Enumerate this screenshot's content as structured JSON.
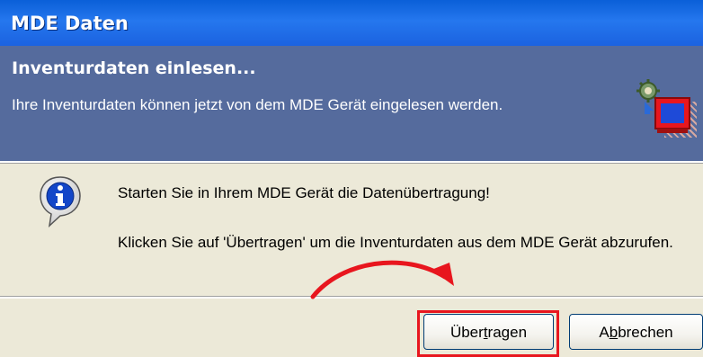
{
  "window": {
    "title": "MDE Daten"
  },
  "header": {
    "title": "Inventurdaten einlesen...",
    "description": "Ihre Inventurdaten können jetzt von dem MDE Gerät eingelesen werden.",
    "icon": "device-transfer-icon"
  },
  "body": {
    "icon": "info-icon",
    "message_line1": "Starten Sie in Ihrem MDE Gerät die Datenübertragung!",
    "message_line2": "Klicken Sie auf 'Übertragen' um die Inventurdaten aus dem MDE Gerät abzurufen."
  },
  "buttons": {
    "transfer": {
      "label_pre": "Über",
      "label_accel": "t",
      "label_post": "ragen",
      "label": "Übertragen"
    },
    "cancel": {
      "label_pre": "A",
      "label_accel": "b",
      "label_post": "brechen",
      "label": "Abbrechen"
    }
  },
  "annotation": {
    "highlight_color": "#e8161e",
    "arrow_color": "#e8161e"
  },
  "colors": {
    "titlebar": "#1b62e0",
    "header_bg": "#556b9d",
    "dialog_bg": "#ece9d8"
  }
}
